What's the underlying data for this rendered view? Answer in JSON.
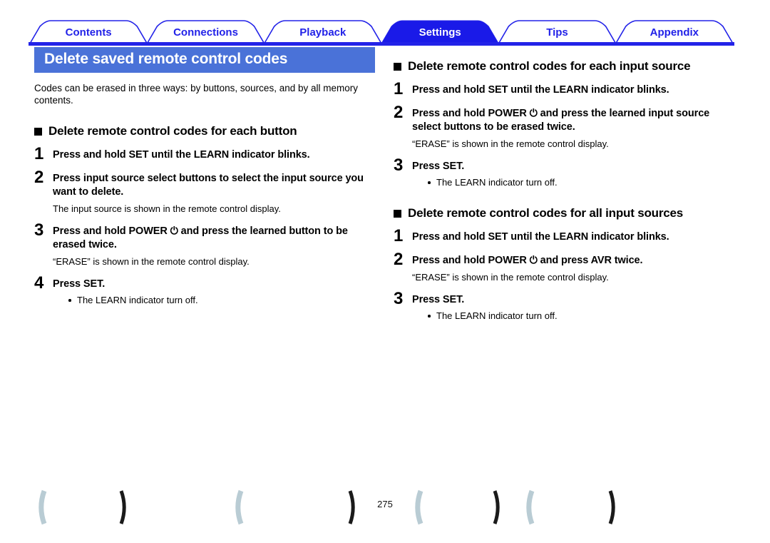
{
  "tabs": [
    {
      "label": "Contents",
      "active": false
    },
    {
      "label": "Connections",
      "active": false
    },
    {
      "label": "Playback",
      "active": false
    },
    {
      "label": "Settings",
      "active": true
    },
    {
      "label": "Tips",
      "active": false
    },
    {
      "label": "Appendix",
      "active": false
    }
  ],
  "colors": {
    "tab_blue": "#2222e8",
    "tab_active_fill": "#1a1ae8",
    "banner_blue": "#4a72d8",
    "rule_blue": "#2222e8",
    "footer_mark_light": "#b9ccd4",
    "footer_mark_dark": "#1a1a1a"
  },
  "banner": {
    "title": "Delete saved remote control codes"
  },
  "intro": "Codes can be erased in three ways: by buttons, sources, and by all memory contents.",
  "icons": {
    "square_bullet": "square-bullet-icon",
    "power": "⏻"
  },
  "left_column": {
    "sections": [
      {
        "heading": "Delete remote control codes for each button",
        "steps": [
          {
            "num": "1",
            "title_parts": [
              {
                "text": "Press and hold ",
                "style": "bold"
              },
              {
                "text": "SET",
                "style": "bold"
              },
              {
                "text": " until the ",
                "style": "bold"
              },
              {
                "text": "LEARN",
                "style": "bold"
              },
              {
                "text": " indicator blinks.",
                "style": "bold"
              }
            ],
            "title": "Press and hold SET until the LEARN indicator blinks.",
            "note": "",
            "bullets": []
          },
          {
            "num": "2",
            "title": "Press input source select buttons to select the input source you want to delete.",
            "note": "The input source is shown in the remote control display.",
            "bullets": []
          },
          {
            "num": "3",
            "title_prefix": "Press and hold POWER ",
            "title_suffix": " and press the learned button to be erased twice.",
            "title": "Press and hold POWER ⏻ and press the learned button to be erased twice.",
            "note": "“ERASE” is shown in the remote control display.",
            "bullets": []
          },
          {
            "num": "4",
            "title": "Press SET.",
            "note": "",
            "bullets": [
              "The LEARN indicator turn off."
            ]
          }
        ]
      }
    ]
  },
  "right_column": {
    "sections": [
      {
        "heading": "Delete remote control codes for each input source",
        "steps": [
          {
            "num": "1",
            "title": "Press and hold SET until the LEARN indicator blinks.",
            "note": "",
            "bullets": []
          },
          {
            "num": "2",
            "title_prefix": "Press and hold POWER ",
            "title_suffix": " and press the learned input source select buttons to be erased twice.",
            "title": "Press and hold POWER ⏻ and press the learned input source select buttons to be erased twice.",
            "note": "“ERASE” is shown in the remote control display.",
            "bullets": []
          },
          {
            "num": "3",
            "title": "Press SET.",
            "note": "",
            "bullets": [
              "The LEARN indicator turn off."
            ]
          }
        ]
      },
      {
        "heading": "Delete remote control codes for all input sources",
        "steps": [
          {
            "num": "1",
            "title": "Press and hold SET until the LEARN indicator blinks.",
            "note": "",
            "bullets": []
          },
          {
            "num": "2",
            "title_prefix": "Press and hold POWER ",
            "title_suffix": " and press AVR twice.",
            "title": "Press and hold POWER ⏻ and press AVR twice.",
            "note": "“ERASE” is shown in the remote control display.",
            "bullets": []
          },
          {
            "num": "3",
            "title": "Press SET.",
            "note": "",
            "bullets": [
              "The LEARN indicator turn off."
            ]
          }
        ]
      }
    ]
  },
  "footer": {
    "page_number": "275"
  }
}
